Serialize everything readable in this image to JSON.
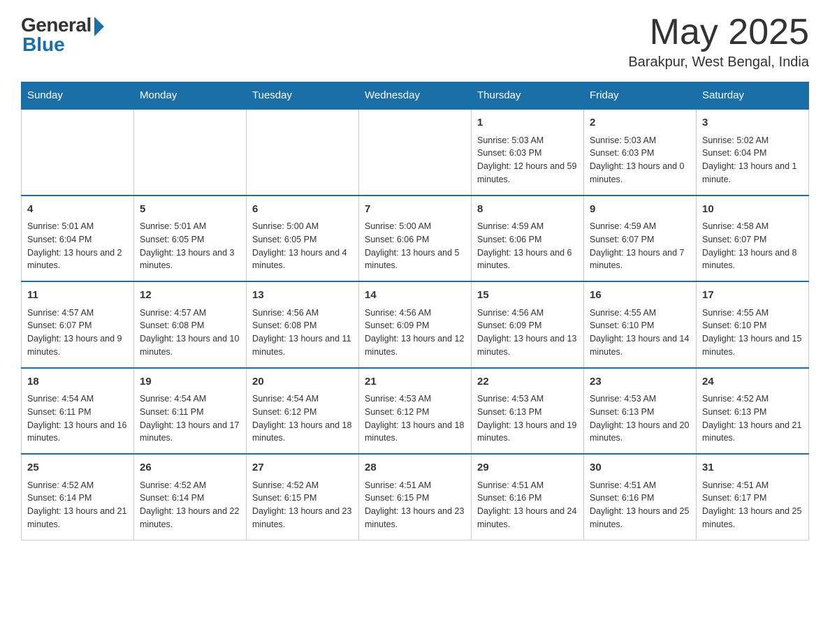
{
  "header": {
    "logo_general": "General",
    "logo_blue": "Blue",
    "month_title": "May 2025",
    "location": "Barakpur, West Bengal, India"
  },
  "weekdays": [
    "Sunday",
    "Monday",
    "Tuesday",
    "Wednesday",
    "Thursday",
    "Friday",
    "Saturday"
  ],
  "weeks": [
    [
      {
        "day": "",
        "sunrise": "",
        "sunset": "",
        "daylight": ""
      },
      {
        "day": "",
        "sunrise": "",
        "sunset": "",
        "daylight": ""
      },
      {
        "day": "",
        "sunrise": "",
        "sunset": "",
        "daylight": ""
      },
      {
        "day": "",
        "sunrise": "",
        "sunset": "",
        "daylight": ""
      },
      {
        "day": "1",
        "sunrise": "Sunrise: 5:03 AM",
        "sunset": "Sunset: 6:03 PM",
        "daylight": "Daylight: 12 hours and 59 minutes."
      },
      {
        "day": "2",
        "sunrise": "Sunrise: 5:03 AM",
        "sunset": "Sunset: 6:03 PM",
        "daylight": "Daylight: 13 hours and 0 minutes."
      },
      {
        "day": "3",
        "sunrise": "Sunrise: 5:02 AM",
        "sunset": "Sunset: 6:04 PM",
        "daylight": "Daylight: 13 hours and 1 minute."
      }
    ],
    [
      {
        "day": "4",
        "sunrise": "Sunrise: 5:01 AM",
        "sunset": "Sunset: 6:04 PM",
        "daylight": "Daylight: 13 hours and 2 minutes."
      },
      {
        "day": "5",
        "sunrise": "Sunrise: 5:01 AM",
        "sunset": "Sunset: 6:05 PM",
        "daylight": "Daylight: 13 hours and 3 minutes."
      },
      {
        "day": "6",
        "sunrise": "Sunrise: 5:00 AM",
        "sunset": "Sunset: 6:05 PM",
        "daylight": "Daylight: 13 hours and 4 minutes."
      },
      {
        "day": "7",
        "sunrise": "Sunrise: 5:00 AM",
        "sunset": "Sunset: 6:06 PM",
        "daylight": "Daylight: 13 hours and 5 minutes."
      },
      {
        "day": "8",
        "sunrise": "Sunrise: 4:59 AM",
        "sunset": "Sunset: 6:06 PM",
        "daylight": "Daylight: 13 hours and 6 minutes."
      },
      {
        "day": "9",
        "sunrise": "Sunrise: 4:59 AM",
        "sunset": "Sunset: 6:07 PM",
        "daylight": "Daylight: 13 hours and 7 minutes."
      },
      {
        "day": "10",
        "sunrise": "Sunrise: 4:58 AM",
        "sunset": "Sunset: 6:07 PM",
        "daylight": "Daylight: 13 hours and 8 minutes."
      }
    ],
    [
      {
        "day": "11",
        "sunrise": "Sunrise: 4:57 AM",
        "sunset": "Sunset: 6:07 PM",
        "daylight": "Daylight: 13 hours and 9 minutes."
      },
      {
        "day": "12",
        "sunrise": "Sunrise: 4:57 AM",
        "sunset": "Sunset: 6:08 PM",
        "daylight": "Daylight: 13 hours and 10 minutes."
      },
      {
        "day": "13",
        "sunrise": "Sunrise: 4:56 AM",
        "sunset": "Sunset: 6:08 PM",
        "daylight": "Daylight: 13 hours and 11 minutes."
      },
      {
        "day": "14",
        "sunrise": "Sunrise: 4:56 AM",
        "sunset": "Sunset: 6:09 PM",
        "daylight": "Daylight: 13 hours and 12 minutes."
      },
      {
        "day": "15",
        "sunrise": "Sunrise: 4:56 AM",
        "sunset": "Sunset: 6:09 PM",
        "daylight": "Daylight: 13 hours and 13 minutes."
      },
      {
        "day": "16",
        "sunrise": "Sunrise: 4:55 AM",
        "sunset": "Sunset: 6:10 PM",
        "daylight": "Daylight: 13 hours and 14 minutes."
      },
      {
        "day": "17",
        "sunrise": "Sunrise: 4:55 AM",
        "sunset": "Sunset: 6:10 PM",
        "daylight": "Daylight: 13 hours and 15 minutes."
      }
    ],
    [
      {
        "day": "18",
        "sunrise": "Sunrise: 4:54 AM",
        "sunset": "Sunset: 6:11 PM",
        "daylight": "Daylight: 13 hours and 16 minutes."
      },
      {
        "day": "19",
        "sunrise": "Sunrise: 4:54 AM",
        "sunset": "Sunset: 6:11 PM",
        "daylight": "Daylight: 13 hours and 17 minutes."
      },
      {
        "day": "20",
        "sunrise": "Sunrise: 4:54 AM",
        "sunset": "Sunset: 6:12 PM",
        "daylight": "Daylight: 13 hours and 18 minutes."
      },
      {
        "day": "21",
        "sunrise": "Sunrise: 4:53 AM",
        "sunset": "Sunset: 6:12 PM",
        "daylight": "Daylight: 13 hours and 18 minutes."
      },
      {
        "day": "22",
        "sunrise": "Sunrise: 4:53 AM",
        "sunset": "Sunset: 6:13 PM",
        "daylight": "Daylight: 13 hours and 19 minutes."
      },
      {
        "day": "23",
        "sunrise": "Sunrise: 4:53 AM",
        "sunset": "Sunset: 6:13 PM",
        "daylight": "Daylight: 13 hours and 20 minutes."
      },
      {
        "day": "24",
        "sunrise": "Sunrise: 4:52 AM",
        "sunset": "Sunset: 6:13 PM",
        "daylight": "Daylight: 13 hours and 21 minutes."
      }
    ],
    [
      {
        "day": "25",
        "sunrise": "Sunrise: 4:52 AM",
        "sunset": "Sunset: 6:14 PM",
        "daylight": "Daylight: 13 hours and 21 minutes."
      },
      {
        "day": "26",
        "sunrise": "Sunrise: 4:52 AM",
        "sunset": "Sunset: 6:14 PM",
        "daylight": "Daylight: 13 hours and 22 minutes."
      },
      {
        "day": "27",
        "sunrise": "Sunrise: 4:52 AM",
        "sunset": "Sunset: 6:15 PM",
        "daylight": "Daylight: 13 hours and 23 minutes."
      },
      {
        "day": "28",
        "sunrise": "Sunrise: 4:51 AM",
        "sunset": "Sunset: 6:15 PM",
        "daylight": "Daylight: 13 hours and 23 minutes."
      },
      {
        "day": "29",
        "sunrise": "Sunrise: 4:51 AM",
        "sunset": "Sunset: 6:16 PM",
        "daylight": "Daylight: 13 hours and 24 minutes."
      },
      {
        "day": "30",
        "sunrise": "Sunrise: 4:51 AM",
        "sunset": "Sunset: 6:16 PM",
        "daylight": "Daylight: 13 hours and 25 minutes."
      },
      {
        "day": "31",
        "sunrise": "Sunrise: 4:51 AM",
        "sunset": "Sunset: 6:17 PM",
        "daylight": "Daylight: 13 hours and 25 minutes."
      }
    ]
  ]
}
